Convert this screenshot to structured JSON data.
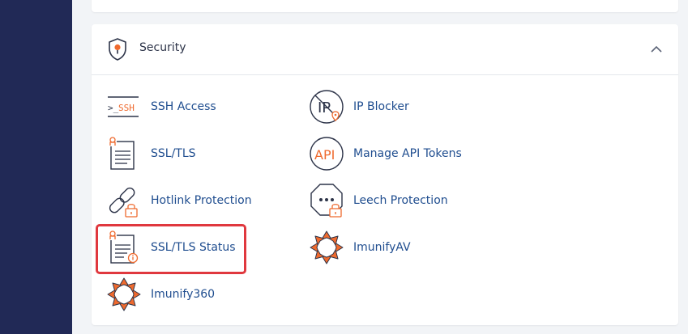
{
  "section": {
    "title": "Security"
  },
  "tools": [
    {
      "label": "SSH Access",
      "icon": "ssh-icon"
    },
    {
      "label": "IP Blocker",
      "icon": "ip-blocker-icon"
    },
    {
      "label": "SSL/TLS",
      "icon": "ssl-tls-icon"
    },
    {
      "label": "Manage API Tokens",
      "icon": "api-tokens-icon"
    },
    {
      "label": "Hotlink Protection",
      "icon": "hotlink-icon"
    },
    {
      "label": "Leech Protection",
      "icon": "leech-icon"
    },
    {
      "label": "SSL/TLS Status",
      "icon": "ssl-status-icon"
    },
    {
      "label": "ImunifyAV",
      "icon": "imunifyav-icon"
    },
    {
      "label": "Imunify360",
      "icon": "imunify360-icon"
    }
  ],
  "icon_text": {
    "ssh_prompt": ">_",
    "ssh": "SSH",
    "ip": "IP",
    "api": "API"
  },
  "colors": {
    "sidebar": "#212956",
    "accent": "#ef6a2e",
    "link": "#1f4d8f",
    "highlight": "#e0383e"
  }
}
